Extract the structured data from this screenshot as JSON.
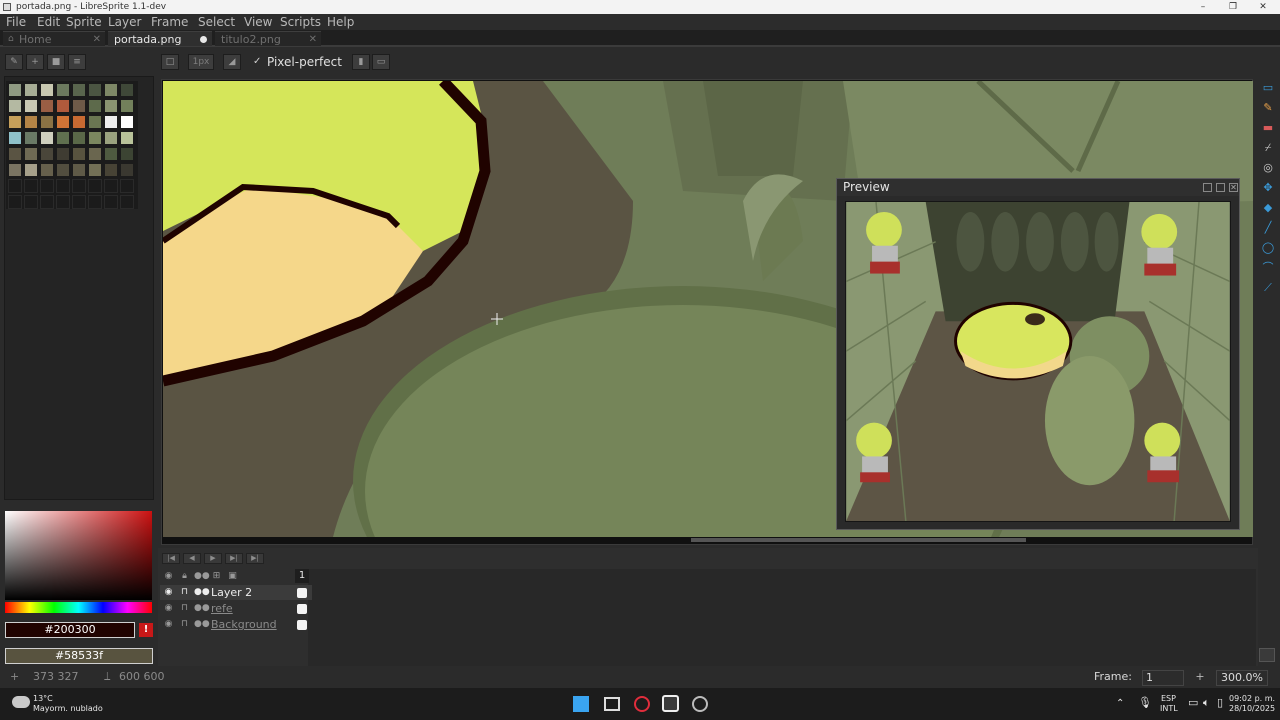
{
  "window": {
    "title": "portada.png - LibreSprite 1.1-dev"
  },
  "menu": [
    "File",
    "Edit",
    "Sprite",
    "Layer",
    "Frame",
    "Select",
    "View",
    "Scripts",
    "Help"
  ],
  "tabs": [
    {
      "label": "Home",
      "icon": "home-icon"
    },
    {
      "label": "portada.png",
      "modified": true
    },
    {
      "label": "titulo2.png"
    }
  ],
  "toolbar": {
    "brush_size": "1px",
    "pixel_perfect_label": "Pixel-perfect",
    "pixel_perfect_checked": true
  },
  "colors": {
    "foreground": "#200300",
    "background": "#58533f"
  },
  "preview": {
    "title": "Preview"
  },
  "layers": [
    {
      "name": "Layer 2",
      "selected": true
    },
    {
      "name": "refe"
    },
    {
      "name": "Background"
    }
  ],
  "frame_header": "1",
  "status": {
    "cursor_pos": "373 327",
    "sprite_size": "600 600",
    "frame_label": "Frame:",
    "frame_value": "1",
    "zoom": "300.0%"
  },
  "taskbar": {
    "temperature": "13°C",
    "weather": "Mayorm. nublado",
    "lang1": "ESP",
    "lang2": "INTL",
    "time": "09:02 p. m.",
    "date": "28/10/2025"
  },
  "icons": {
    "tool_icons": [
      "marquee-icon",
      "pencil-icon",
      "eraser-icon",
      "eyedropper-icon",
      "zoom-icon",
      "move-icon",
      "fill-icon",
      "line-icon",
      "ellipse-icon",
      "contour-icon",
      "blur-icon"
    ]
  }
}
